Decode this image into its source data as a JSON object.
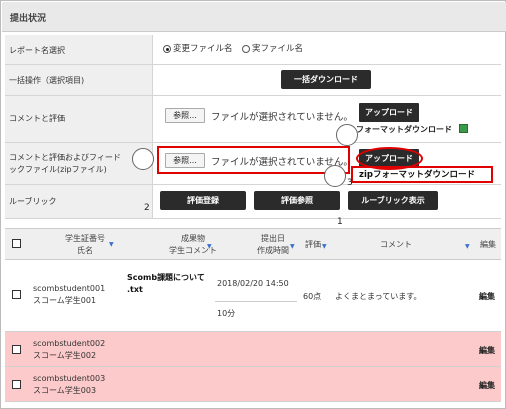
{
  "header": {
    "title": "提出状況"
  },
  "form": {
    "report_name": {
      "label": "レポート名選択",
      "options": [
        "変更ファイル名",
        "実ファイル名"
      ],
      "selected": "変更ファイル名"
    },
    "bulk": {
      "label": "一括操作（選択項目)",
      "button": "一括ダウンロード"
    },
    "comment": {
      "label": "コメントと評価",
      "browse": "参照...",
      "no_file": "ファイルが選択されていません。",
      "upload": "アップロード",
      "format_download": "フォーマットダウンロード"
    },
    "zip": {
      "label_line1": "コメントと評価およびフィード",
      "label_line2": "ックファイル(zipファイル)",
      "browse": "参照...",
      "no_file": "ファイルが選択されていません。",
      "upload": "アップロード",
      "format_download": "zipフォーマットダウンロード"
    },
    "rubric": {
      "label": "ルーブリック",
      "buttons": [
        "評価登録",
        "評価参照",
        "ルーブリック表示"
      ]
    }
  },
  "annotations": [
    "2",
    "1",
    "3"
  ],
  "table": {
    "headers": {
      "student_line1": "学生証番号",
      "student_line2": "氏名",
      "deliverable_line1": "成果物",
      "deliverable_line2": "学生コメント",
      "submit_line1": "提出日",
      "submit_line2": "作成時間",
      "score": "評価",
      "comment": "コメント",
      "edit": "編集"
    },
    "rows": [
      {
        "student_id": "scombstudent001",
        "name": "スコーム学生001",
        "file_line1": "Scomb課題について",
        "file_line2": ".txt",
        "date": "2018/02/20 14:50",
        "time": "10分",
        "score": "60点",
        "comment": "よくまとまっています。",
        "edit": "編集"
      },
      {
        "student_id": "scombstudent002",
        "name": "スコーム学生002",
        "edit": "編集"
      },
      {
        "student_id": "scombstudent003",
        "name": "スコーム学生003",
        "edit": "編集"
      }
    ]
  },
  "colors": {
    "highlight_red": "#e00000",
    "unsubmitted_row": "#fccaca",
    "button_dark": "#2b2b2b"
  },
  "icons": {
    "sort": "sort-arrow-icon",
    "csv": "spreadsheet-icon"
  }
}
